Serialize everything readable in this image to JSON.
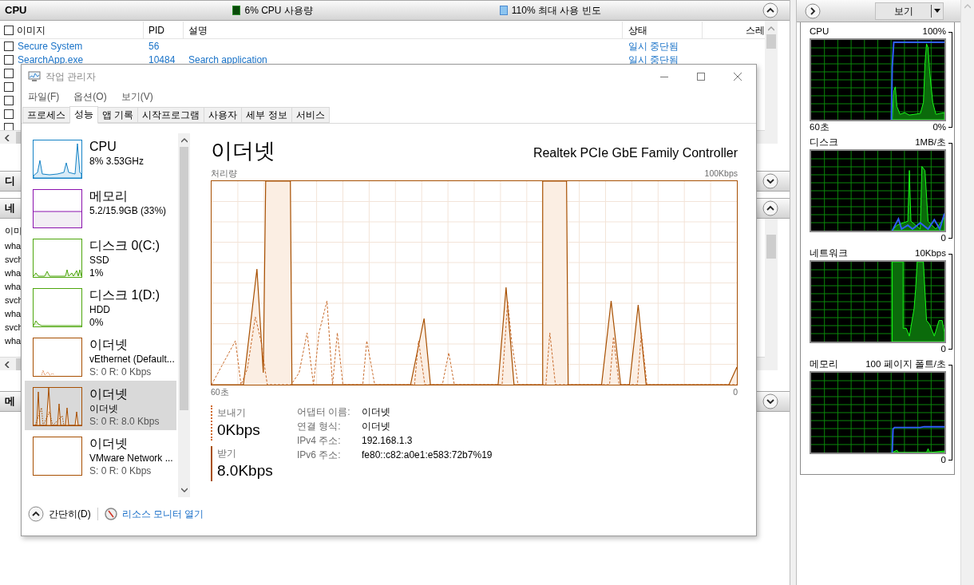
{
  "resource_monitor": {
    "cpu_section": {
      "title": "CPU",
      "usage": "6% CPU 사용량",
      "max_frequency": "110% 최대 사용 빈도",
      "expanded": true
    },
    "process_table": {
      "columns": [
        "이미지",
        "PID",
        "설명",
        "상태",
        "스레"
      ],
      "header_checked": false,
      "rows": [
        {
          "image": "Secure System",
          "pid": "56",
          "status": "일시 중단됨",
          "checked": false
        },
        {
          "image": "SearchApp.exe",
          "pid": "10484",
          "description": "Search application",
          "status": "일시 중단됨",
          "checked": false
        },
        {
          "checked": false
        },
        {
          "checked": false
        },
        {
          "checked": false
        },
        {
          "checked": false
        },
        {
          "checked": false
        }
      ]
    },
    "disk_section": {
      "title": "디",
      "expanded": false
    },
    "network_section": {
      "title": "네",
      "expanded": true
    },
    "network_table": {
      "columns": [
        "이미"
      ],
      "rows": [
        "wha",
        "svch",
        "wha",
        "wha",
        "svch",
        "wha",
        "svch",
        "wha"
      ]
    },
    "memory_section": {
      "title": "메",
      "expanded": false
    },
    "view_button": "보기",
    "graphs": [
      {
        "kind": "cpu",
        "label": "CPU",
        "max": "100%",
        "time": "60초",
        "min": "0%"
      },
      {
        "kind": "disk",
        "label": "디스크",
        "max": "1MB/초",
        "min": "0"
      },
      {
        "kind": "network",
        "label": "네트워크",
        "max": "10Kbps",
        "min": "0"
      },
      {
        "kind": "memory",
        "label": "메모리",
        "max": "100 페이지 폴트/초",
        "min": "0"
      }
    ]
  },
  "task_manager": {
    "title": "작업 관리자",
    "menu": [
      "파일(F)",
      "옵션(O)",
      "보기(V)"
    ],
    "tabs": [
      {
        "label": "프로세스",
        "selected": false
      },
      {
        "label": "성능",
        "selected": true
      },
      {
        "label": "앱 기록",
        "selected": false
      },
      {
        "label": "시작프로그램",
        "selected": false
      },
      {
        "label": "사용자",
        "selected": false
      },
      {
        "label": "세부 정보",
        "selected": false
      },
      {
        "label": "서비스",
        "selected": false
      }
    ],
    "sidebar": [
      {
        "kind": "cpu",
        "title": "CPU",
        "lines": [
          "8% 3.53GHz"
        ],
        "selected": false
      },
      {
        "kind": "memory",
        "title": "메모리",
        "lines": [
          "5.2/15.9GB (33%)"
        ],
        "selected": false
      },
      {
        "kind": "disk",
        "title": "디스크 0(C:)",
        "lines": [
          "SSD",
          "1%"
        ],
        "selected": false
      },
      {
        "kind": "disk",
        "title": "디스크 1(D:)",
        "lines": [
          "HDD",
          "0%"
        ],
        "selected": false
      },
      {
        "kind": "ethernet",
        "title": "이더넷",
        "lines": [
          "vEthernet (Default...",
          "S: 0 R: 0 Kbps"
        ],
        "selected": false
      },
      {
        "kind": "ethernet",
        "title": "이더넷",
        "lines": [
          "이더넷",
          "S: 0 R: 8.0 Kbps"
        ],
        "selected": true
      },
      {
        "kind": "ethernet",
        "title": "이더넷",
        "lines": [
          "VMware Network ...",
          "S: 0 R: 0 Kbps"
        ],
        "selected": false
      }
    ],
    "detail": {
      "title": "이더넷",
      "adapter": "Realtek PCIe GbE Family Controller",
      "graph_label": "처리량",
      "graph_max": "100Kbps",
      "time_start": "60초",
      "time_end": "0",
      "send_label": "보내기",
      "send_value": "0Kbps",
      "receive_label": "받기",
      "receive_value": "8.0Kbps",
      "properties": [
        {
          "label": "어댑터 이름:",
          "value": "이더넷"
        },
        {
          "label": "연결 형식:",
          "value": "이더넷"
        },
        {
          "label": "IPv4 주소:",
          "value": "192.168.1.3"
        },
        {
          "label": "IPv6 주소:",
          "value": "fe80::c82:a0e1:e583:72b7%19"
        }
      ]
    },
    "fewer_details": "간단히(D)",
    "open_resource_monitor": "리소스 모니터 열기"
  }
}
